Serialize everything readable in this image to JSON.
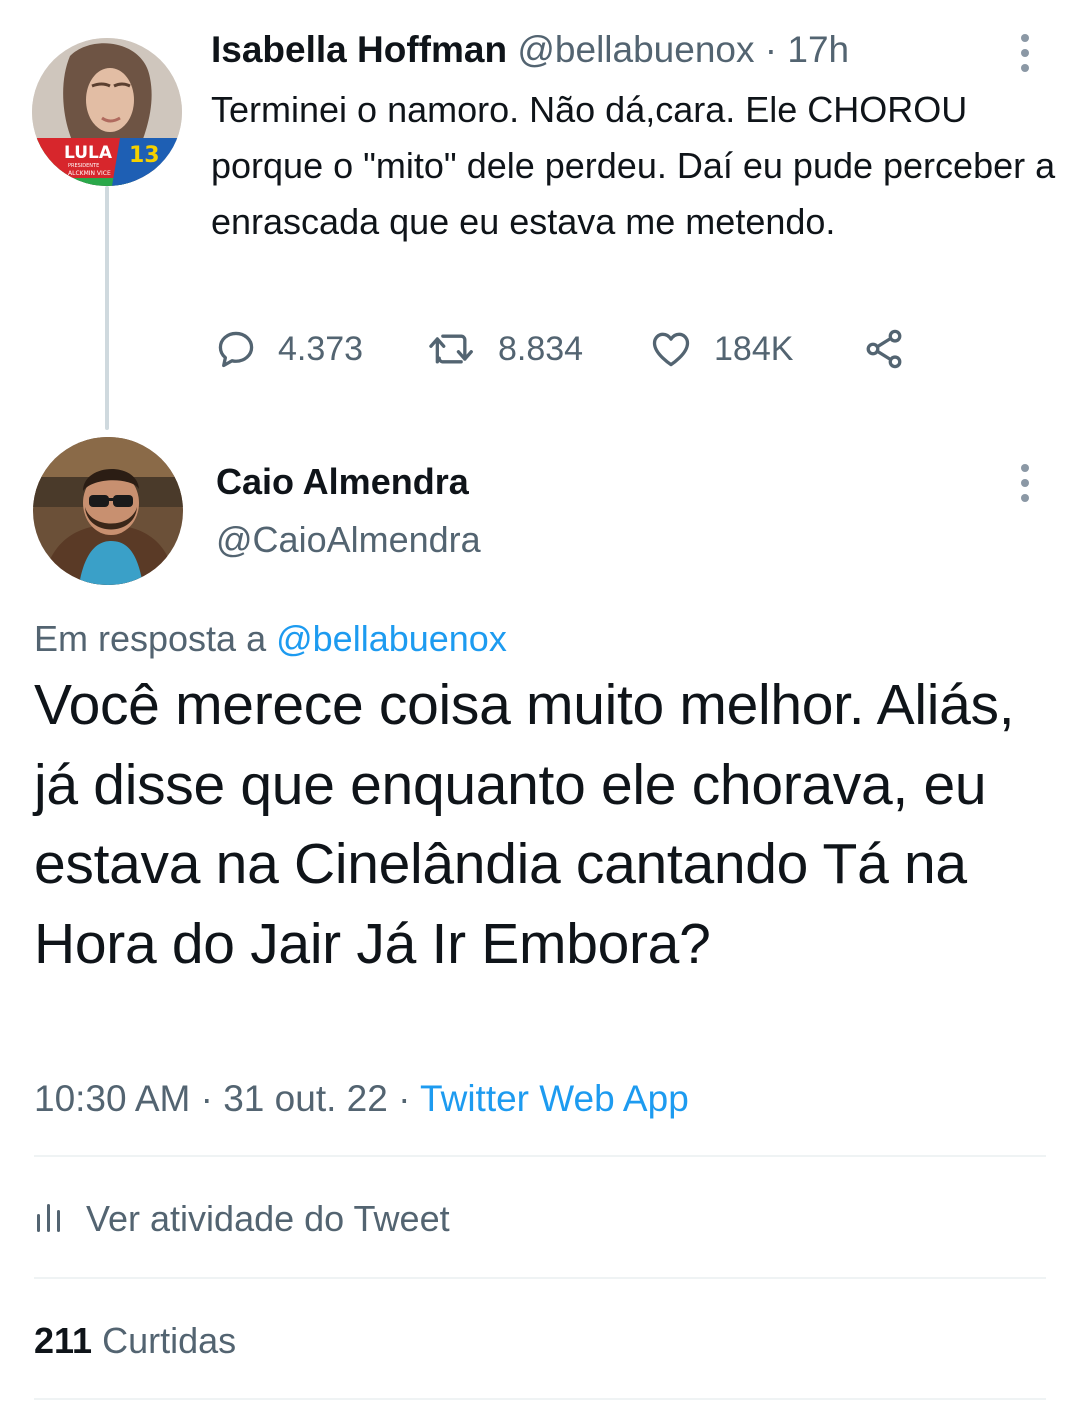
{
  "parent_tweet": {
    "name": "Isabella Hoffman",
    "handle": "@bellabuenox",
    "separator": " · ",
    "time": "17h",
    "text": "Terminei o namoro. Não dá,cara. Ele CHOROU porque o \"mito\" dele perdeu. Daí eu pude perceber a enrascada que eu estava me metendo.",
    "avatar_badge": {
      "lula": "LULA",
      "number": "13",
      "presidente": "PRESIDENTE",
      "alckmin": "ALCKMIN VICE"
    },
    "actions": {
      "replies": "4.373",
      "retweets": "8.834",
      "likes": "184K"
    },
    "colors": {
      "badge_red": "#d7262c",
      "badge_blue": "#1e5fb4",
      "badge_green": "#2aa84a"
    }
  },
  "main_tweet": {
    "name": "Caio Almendra",
    "handle": "@CaioAlmendra",
    "reply_prefix": "Em resposta a ",
    "reply_mention": "@bellabuenox",
    "text": "Você merece coisa muito melhor. Aliás, já disse que enquanto ele chorava, eu estava na Cinelândia cantando Tá na Hora do Jair Já Ir Embora?",
    "time": "10:30 AM",
    "separator1": " · ",
    "date": "31 out. 22",
    "separator2": " · ",
    "source": "Twitter Web App"
  },
  "activity": {
    "label": "Ver atividade do Tweet"
  },
  "likes": {
    "count": "211",
    "label": " Curtidas"
  },
  "icons": {
    "more": "more-vertical-icon",
    "reply": "reply-icon",
    "retweet": "retweet-icon",
    "like": "heart-icon",
    "share": "share-icon",
    "activity": "bar-chart-icon"
  },
  "colors": {
    "link": "#1d9bf0",
    "secondary": "#536471",
    "primary": "#0f1419",
    "divider": "#eff3f4"
  }
}
